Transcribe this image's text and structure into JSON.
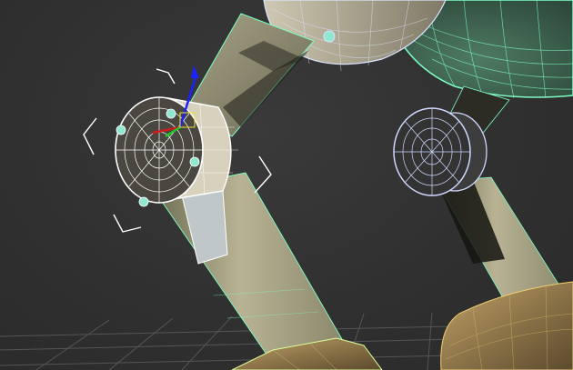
{
  "viewport": {
    "background": "#303030",
    "grid_color": "#5a5a5a",
    "selection_wire_color": "#ffffff",
    "object_wire_color_green": "#7dffc4",
    "object_wire_color_blue": "#cfd8ff",
    "gizmo": {
      "x_axis_color": "#d01b1b",
      "y_axis_color": "#1ecb2a",
      "z_axis_color": "#1a22ff"
    },
    "selection_brackets": "white",
    "texture": "weathered-wood"
  }
}
